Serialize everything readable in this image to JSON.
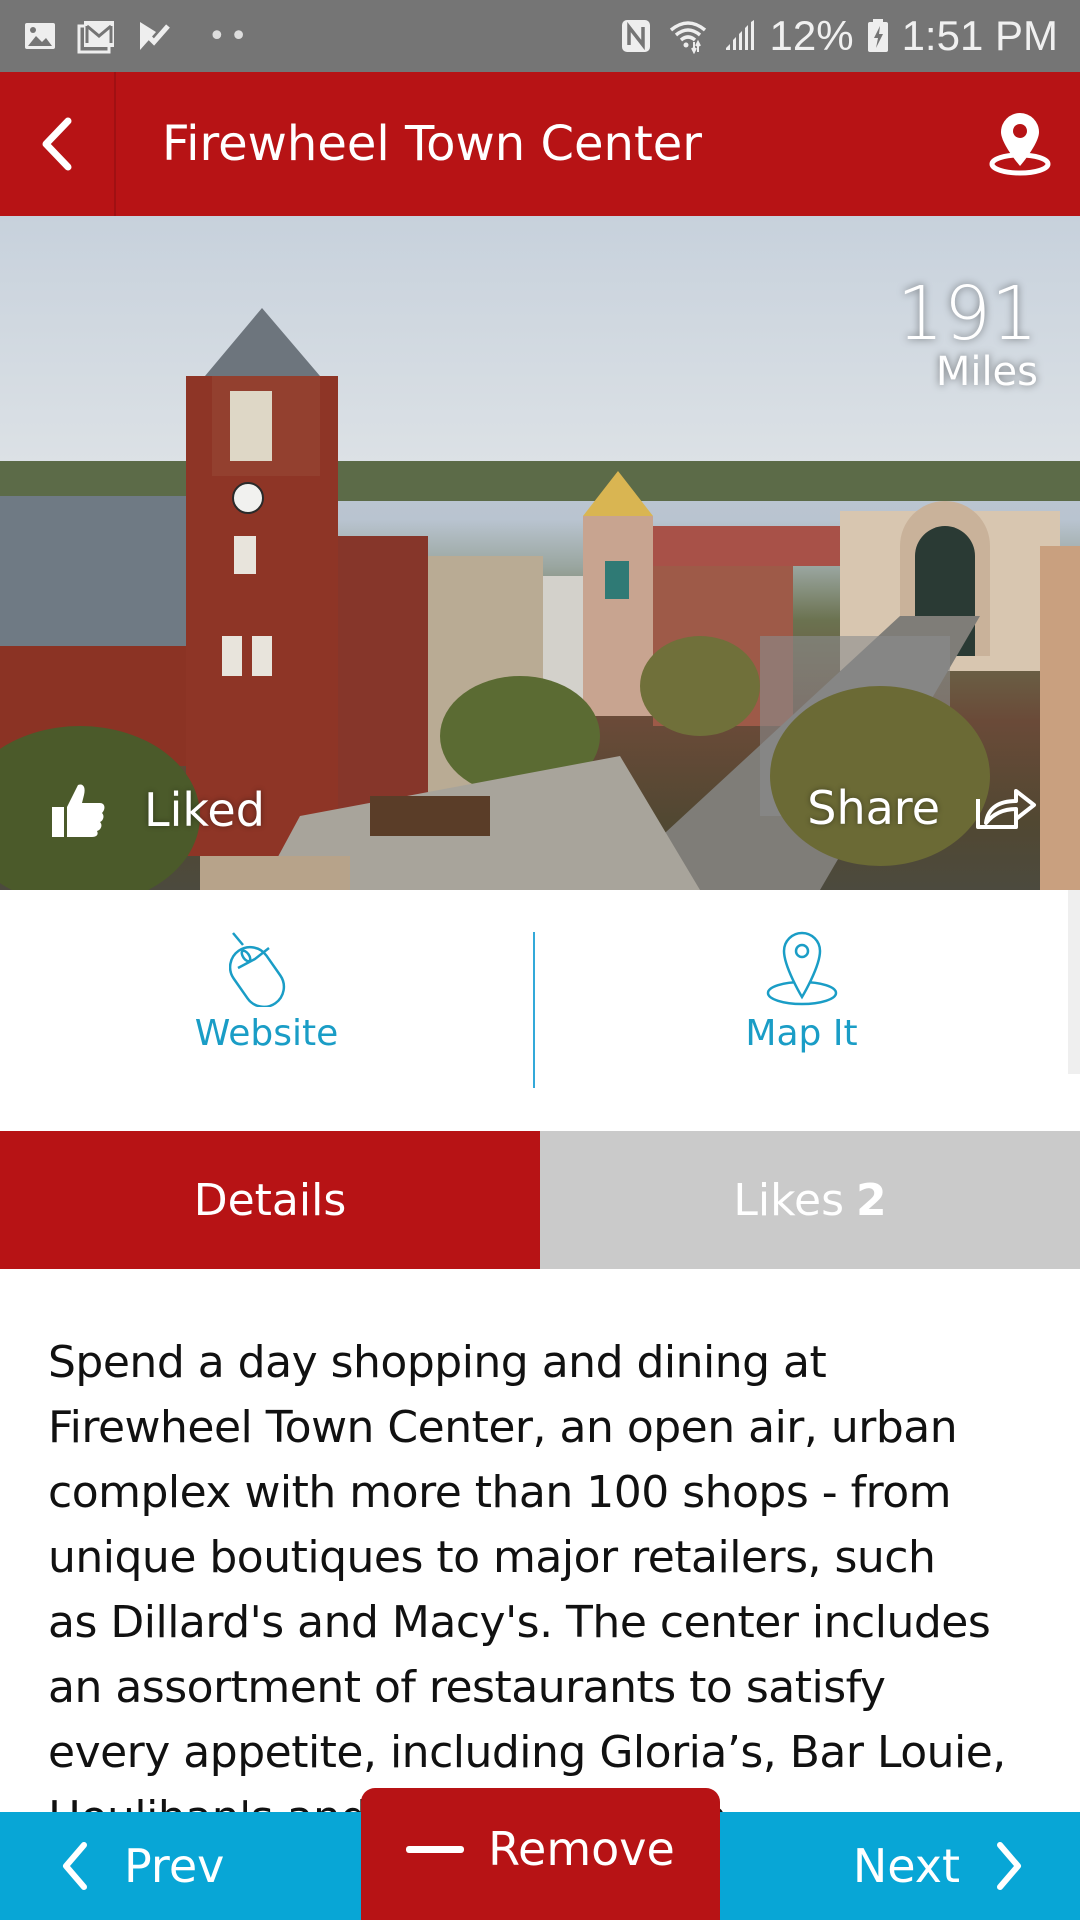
{
  "status_bar": {
    "left_icons": [
      "gallery-icon",
      "gmail-icon",
      "task-check-icon",
      "more-dots-icon"
    ],
    "right_icons": [
      "nfc-icon",
      "wifi-icon",
      "signal-icon"
    ],
    "battery_percent": "12%",
    "time": "1:51 PM"
  },
  "header": {
    "title": "Firewheel Town Center",
    "back_icon": "chevron-left-icon",
    "location_icon": "map-pin-icon"
  },
  "hero": {
    "distance_value": "191",
    "distance_unit": "Miles",
    "liked_label": "Liked",
    "share_label": "Share"
  },
  "actions": [
    {
      "label": "Website",
      "icon": "mouse-icon"
    },
    {
      "label": "Map It",
      "icon": "map-pin-icon"
    }
  ],
  "tabs": [
    {
      "label": "Details",
      "active": true
    },
    {
      "label": "Likes",
      "count": "2",
      "active": false
    }
  ],
  "description": {
    "lines": [
      "Spend a day shopping and dining at",
      "Firewheel Town Center, an open air, urban",
      "complex with more than 100 shops - from",
      "unique boutiques to major retailers, such",
      "as Dillard's and Macy's. The center includes",
      "an assortment of restaurants to satisfy",
      "every appetite, including Gloria’s, Bar Louie,",
      "Houlihan's and ... along with an"
    ]
  },
  "bottom_nav": {
    "prev_label": "Prev",
    "remove_label": "Remove",
    "next_label": "Next"
  },
  "colors": {
    "brand_red": "#b71315",
    "accent_blue": "#08a6d6",
    "link_blue": "#1a9dc6",
    "tab_inactive": "#cacaca",
    "status_bar": "#757575"
  }
}
